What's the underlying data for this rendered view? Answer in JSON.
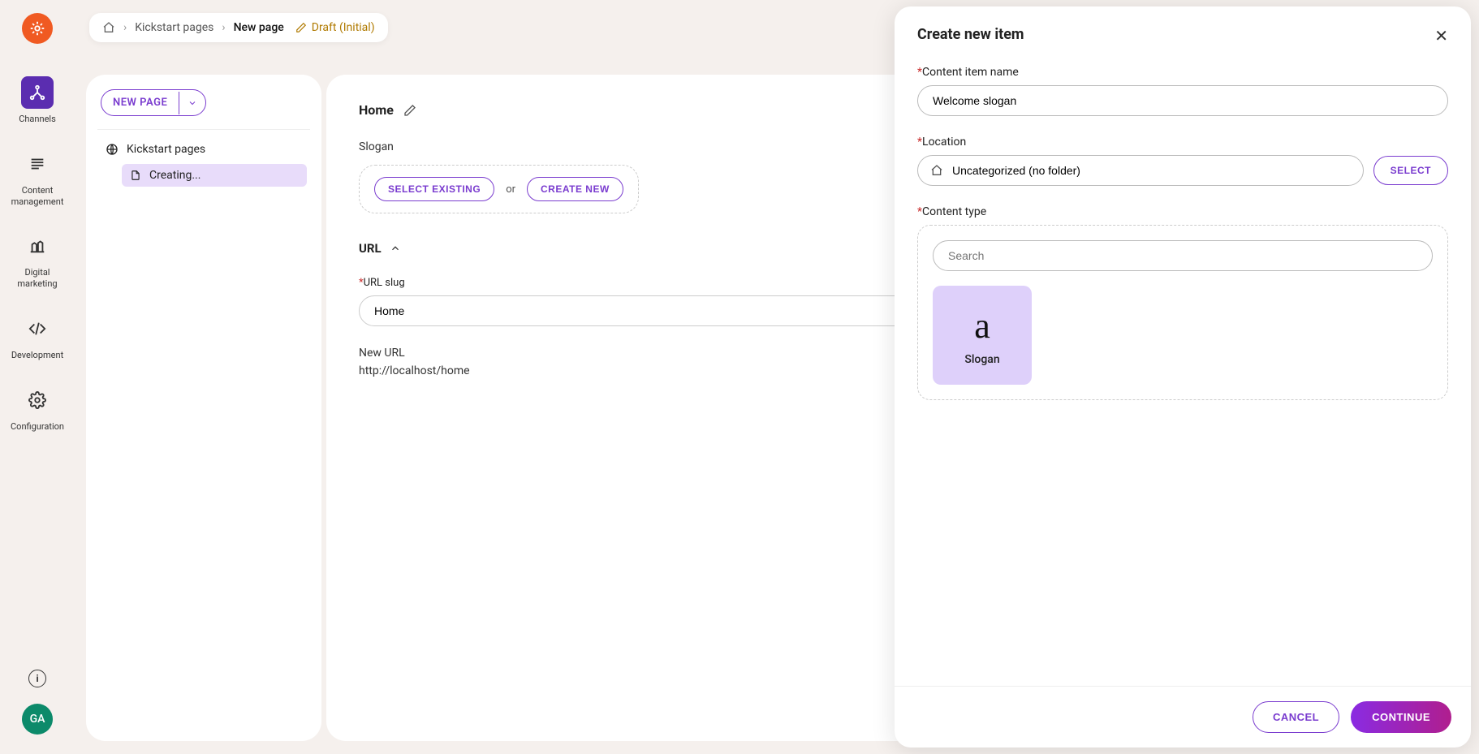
{
  "nav": {
    "items": [
      {
        "label": "Channels"
      },
      {
        "label": "Content management"
      },
      {
        "label": "Digital marketing"
      },
      {
        "label": "Development"
      },
      {
        "label": "Configuration"
      }
    ],
    "avatar_initials": "GA"
  },
  "breadcrumb": {
    "level1": "Kickstart pages",
    "current": "New page",
    "status": "Draft (Initial)"
  },
  "tree": {
    "new_page_label": "NEW PAGE",
    "root_label": "Kickstart pages",
    "child_label": "Creating..."
  },
  "main": {
    "title": "Home",
    "slogan_label": "Slogan",
    "select_existing": "SELECT EXISTING",
    "or_text": "or",
    "create_new": "CREATE NEW",
    "url_section": "URL",
    "url_slug_label": "URL slug",
    "url_slug_value": "Home",
    "new_url_label": "New URL",
    "new_url_value": "http://localhost/home"
  },
  "modal": {
    "title": "Create new item",
    "name_label": "Content item name",
    "name_value": "Welcome slogan",
    "location_label": "Location",
    "location_value": "Uncategorized (no folder)",
    "select_btn": "SELECT",
    "content_type_label": "Content type",
    "search_placeholder": "Search",
    "type_card_label": "Slogan",
    "cancel": "CANCEL",
    "continue": "CONTINUE"
  }
}
